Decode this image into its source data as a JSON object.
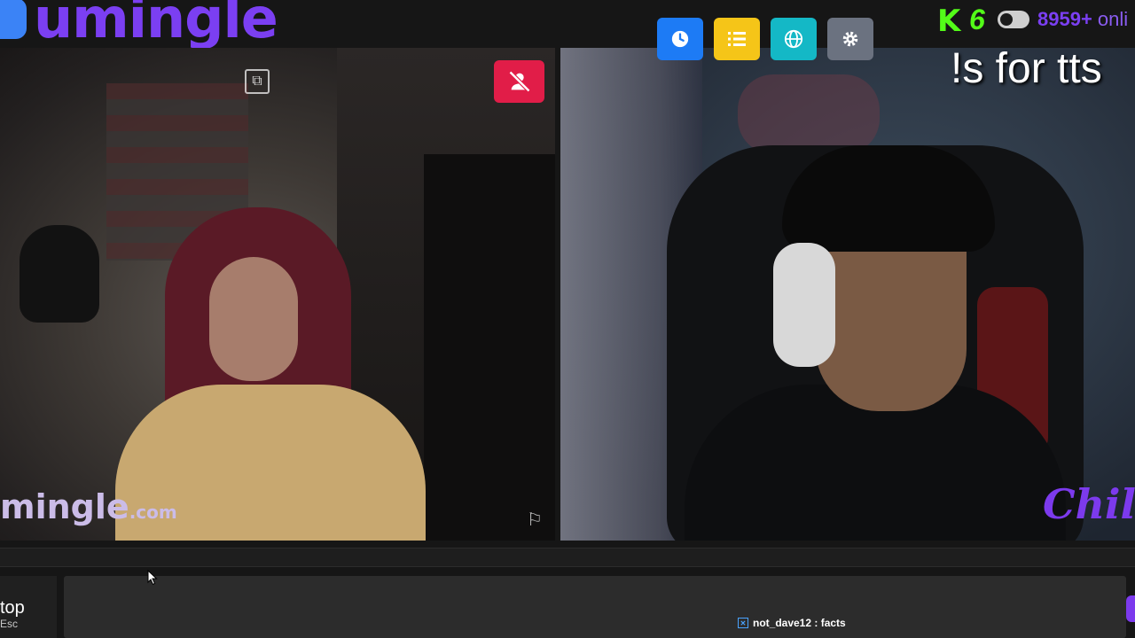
{
  "app": {
    "logo_text": "umingle"
  },
  "toolbar": {
    "history_icon": "clock-icon",
    "list_icon": "list-icon",
    "globe_icon": "globe-icon",
    "settings_icon": "gear-icon"
  },
  "stream": {
    "platform_badge": "K",
    "badge_count": "6",
    "online_count": "8959+",
    "online_suffix": "onli",
    "overlay_text": "!s for tts",
    "channel_badge": "Chill"
  },
  "video_left": {
    "watermark_main": "mingle",
    "watermark_domain": ".com"
  },
  "controls": {
    "stop_label": "top",
    "stop_shortcut": "Esc",
    "chat_placeholder": ""
  },
  "chat": {
    "messages": [
      {
        "user": "not_dave12",
        "text": "facts",
        "display": "not_dave12 : facts"
      }
    ]
  },
  "colors": {
    "brand_purple": "#7b3ff2",
    "kick_green": "#53fc18",
    "mute_red": "#e11d48",
    "history_blue": "#1d7bf5",
    "list_yellow": "#f5c518",
    "globe_teal": "#14b8c6",
    "settings_gray": "#6b7280"
  }
}
